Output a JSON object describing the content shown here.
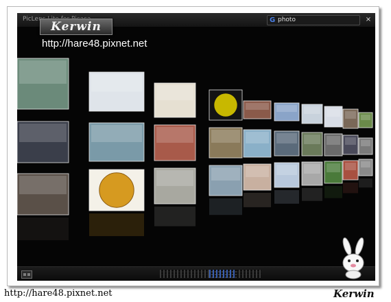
{
  "window": {
    "title": "PicLens Lite for Picasa",
    "search_value": "photo",
    "search_icon": "google-g-icon",
    "close_label": "×"
  },
  "watermark": {
    "logo_text": "Kerwin",
    "url": "http://hare48.pixnet.net"
  },
  "footer": {
    "url": "http://hare48.pixnet.net",
    "signature": "Kerwin"
  },
  "bottombar": {
    "grid_icon": "grid-view-icon",
    "scrubber_icon": "page-scrubber"
  },
  "colors": {
    "background": "#050505",
    "search_accent": "#4a7fe6",
    "scrubber_active": "#3a5fb0"
  },
  "photos": {
    "row1": [
      {
        "name": "photo-couple-pool",
        "tone": "#6b8a7a"
      },
      {
        "name": "photo-website-screenshot",
        "tone": "#dfe4ea"
      },
      {
        "name": "photo-sketch-figures",
        "tone": "#e6e0d2"
      },
      {
        "name": "photo-yellow-ball",
        "tone": "#c8b800"
      },
      {
        "name": "photo-crowd",
        "tone": "#8a5a4a"
      },
      {
        "name": "photo-cloudy-sky",
        "tone": "#8aa4c8"
      },
      {
        "name": "photo-web-grid",
        "tone": "#c8d2dc"
      },
      {
        "name": "photo-web-page",
        "tone": "#d8dde6"
      },
      {
        "name": "photo-people-street",
        "tone": "#7a6858"
      },
      {
        "name": "photo-plants",
        "tone": "#6a8a4a"
      }
    ],
    "row2": [
      {
        "name": "photo-group-suits",
        "tone": "#3a3e4a"
      },
      {
        "name": "photo-collage-people",
        "tone": "#7a9aa8"
      },
      {
        "name": "photo-mosaic-portrait",
        "tone": "#a85a4a"
      },
      {
        "name": "photo-building",
        "tone": "#8a7a5a"
      },
      {
        "name": "photo-statue-liberty",
        "tone": "#8ab0c8"
      },
      {
        "name": "photo-couple-street",
        "tone": "#5a6a7a"
      },
      {
        "name": "photo-people-outdoor",
        "tone": "#6a7a5a"
      },
      {
        "name": "photo-city-walk",
        "tone": "#6a6a6a"
      },
      {
        "name": "photo-person-portrait",
        "tone": "#4a4a5a"
      },
      {
        "name": "photo-texture",
        "tone": "#7a7a7a"
      }
    ],
    "row3": [
      {
        "name": "photo-old-prints",
        "tone": "#5a5048"
      },
      {
        "name": "photo-gold-coin",
        "tone": "#d69a20"
      },
      {
        "name": "photo-couple-bw",
        "tone": "#a8a8a0"
      },
      {
        "name": "photo-modern-house",
        "tone": "#8aa0b0"
      },
      {
        "name": "photo-map-page",
        "tone": "#c8b0a0"
      },
      {
        "name": "photo-web-blue",
        "tone": "#b8c8dc"
      },
      {
        "name": "photo-tall-building",
        "tone": "#a8a8a8"
      },
      {
        "name": "photo-green-field",
        "tone": "#4a7a3a"
      },
      {
        "name": "photo-red-abstract",
        "tone": "#a85040"
      },
      {
        "name": "photo-grey-pattern",
        "tone": "#8a8a8a"
      }
    ]
  }
}
